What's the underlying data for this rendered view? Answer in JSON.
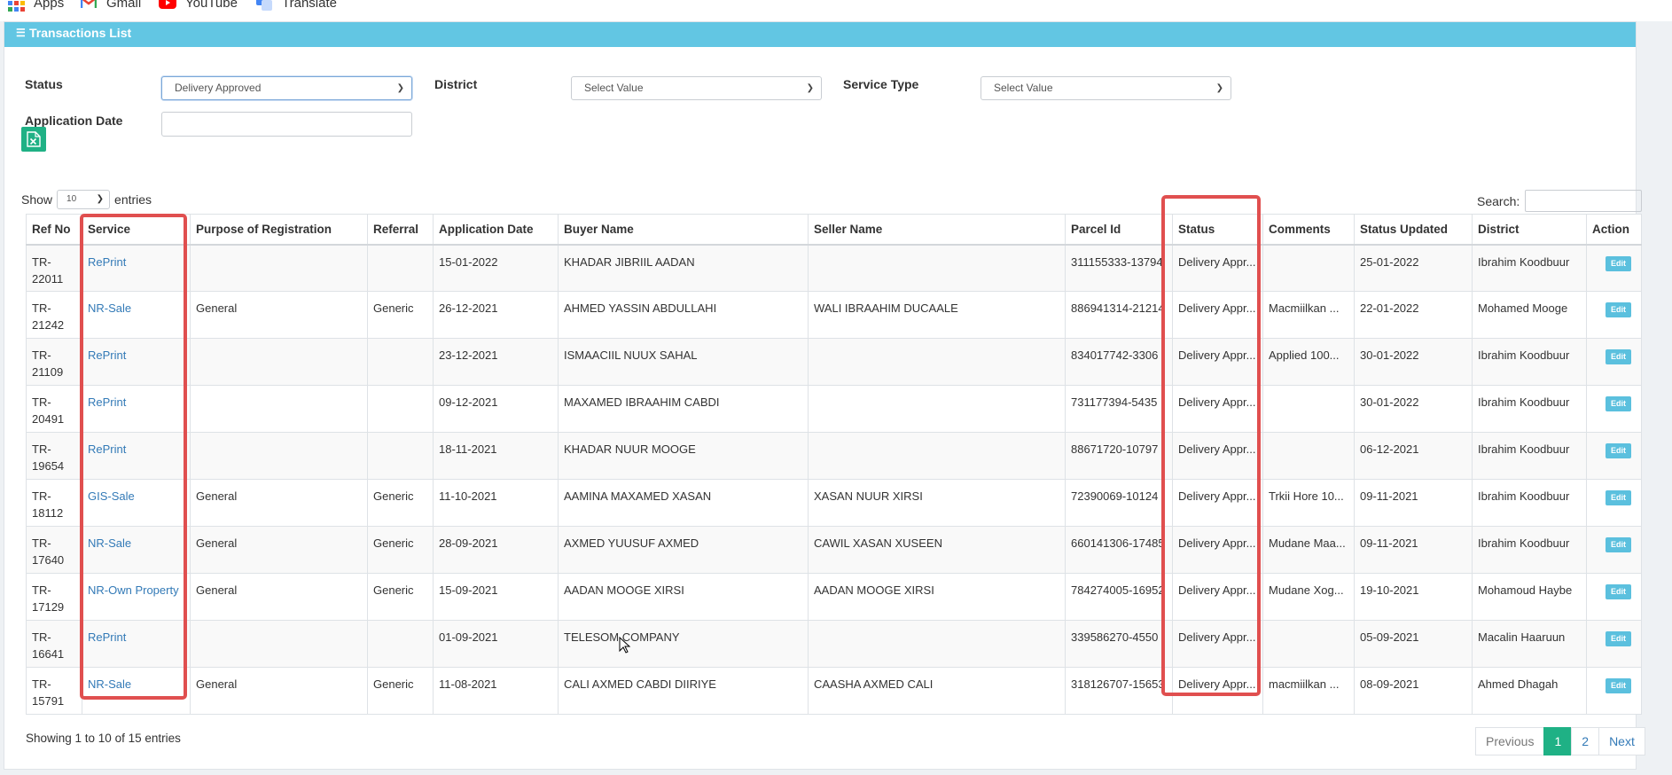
{
  "bookmarks": [
    {
      "label": "Apps",
      "icon": "apps-grid-icon"
    },
    {
      "label": "Gmail",
      "icon": "gmail-icon"
    },
    {
      "label": "YouTube",
      "icon": "youtube-icon"
    },
    {
      "label": "Translate",
      "icon": "translate-icon"
    }
  ],
  "panel": {
    "title": "Transactions List",
    "icon": "list-icon"
  },
  "filters": {
    "status": {
      "label": "Status",
      "value": "Delivery Approved"
    },
    "district": {
      "label": "District",
      "value": "Select Value"
    },
    "service_type": {
      "label": "Service Type",
      "value": "Select Value"
    },
    "application_date": {
      "label": "Application Date",
      "value": ""
    }
  },
  "export": {
    "icon": "excel-export-icon"
  },
  "length_menu": {
    "prefix": "Show",
    "value": "10",
    "suffix": "entries"
  },
  "search": {
    "label": "Search:",
    "value": ""
  },
  "table": {
    "columns": [
      "Ref No",
      "Service",
      "Purpose of Registration",
      "Referral",
      "Application Date",
      "Buyer Name",
      "Seller Name",
      "Parcel Id",
      "Status",
      "Comments",
      "Status Updated",
      "District",
      "Action"
    ],
    "rows": [
      {
        "ref": "TR-22011",
        "service": "RePrint",
        "purpose": "",
        "referral": "",
        "app_date": "15-01-2022",
        "buyer": "KHADAR JIBRIIL AADAN",
        "seller": "",
        "parcel": "311155333-13794",
        "status": "Delivery Appr...",
        "comments": "",
        "updated": "25-01-2022",
        "district": "Ibrahim Koodbuur",
        "action": "Edit"
      },
      {
        "ref": "TR-21242",
        "service": "NR-Sale",
        "purpose": "General",
        "referral": "Generic",
        "app_date": "26-12-2021",
        "buyer": "AHMED YASSIN ABDULLAHI",
        "seller": "WALI IBRAAHIM DUCAALE",
        "parcel": "886941314-21214",
        "status": "Delivery Appr...",
        "comments": "Macmiilkan ...",
        "updated": "22-01-2022",
        "district": "Mohamed Mooge",
        "action": "Edit"
      },
      {
        "ref": "TR-21109",
        "service": "RePrint",
        "purpose": "",
        "referral": "",
        "app_date": "23-12-2021",
        "buyer": "ISMAACIIL NUUX SAHAL",
        "seller": "",
        "parcel": "834017742-3306",
        "status": "Delivery Appr...",
        "comments": "Applied 100...",
        "updated": "30-01-2022",
        "district": "Ibrahim Koodbuur",
        "action": "Edit"
      },
      {
        "ref": "TR-20491",
        "service": "RePrint",
        "purpose": "",
        "referral": "",
        "app_date": "09-12-2021",
        "buyer": "MAXAMED IBRAAHIM CABDI",
        "seller": "",
        "parcel": "731177394-5435",
        "status": "Delivery Appr...",
        "comments": "",
        "updated": "30-01-2022",
        "district": "Ibrahim Koodbuur",
        "action": "Edit"
      },
      {
        "ref": "TR-19654",
        "service": "RePrint",
        "purpose": "",
        "referral": "",
        "app_date": "18-11-2021",
        "buyer": "KHADAR NUUR MOOGE",
        "seller": "",
        "parcel": "88671720-10797",
        "status": "Delivery Appr...",
        "comments": "",
        "updated": "06-12-2021",
        "district": "Ibrahim Koodbuur",
        "action": "Edit"
      },
      {
        "ref": "TR-18112",
        "service": "GIS-Sale",
        "purpose": "General",
        "referral": "Generic",
        "app_date": "11-10-2021",
        "buyer": "AAMINA MAXAMED XASAN",
        "seller": "XASAN NUUR XIRSI",
        "parcel": "72390069-10124",
        "status": "Delivery Appr...",
        "comments": "Trkii Hore 10...",
        "updated": "09-11-2021",
        "district": "Ibrahim Koodbuur",
        "action": "Edit"
      },
      {
        "ref": "TR-17640",
        "service": "NR-Sale",
        "purpose": "General",
        "referral": "Generic",
        "app_date": "28-09-2021",
        "buyer": "AXMED YUUSUF AXMED",
        "seller": "CAWIL XASAN XUSEEN",
        "parcel": "660141306-17485",
        "status": "Delivery Appr...",
        "comments": "Mudane Maa...",
        "updated": "09-11-2021",
        "district": "Ibrahim Koodbuur",
        "action": "Edit"
      },
      {
        "ref": "TR-17129",
        "service": "NR-Own Property",
        "purpose": "General",
        "referral": "Generic",
        "app_date": "15-09-2021",
        "buyer": "AADAN MOOGE XIRSI",
        "seller": "AADAN MOOGE XIRSI",
        "parcel": "784274005-16952",
        "status": "Delivery Appr...",
        "comments": "Mudane Xog...",
        "updated": "19-10-2021",
        "district": "Mohamoud Haybe",
        "action": "Edit"
      },
      {
        "ref": "TR-16641",
        "service": "RePrint",
        "purpose": "",
        "referral": "",
        "app_date": "01-09-2021",
        "buyer": "TELESOM COMPANY",
        "seller": "",
        "parcel": "339586270-4550",
        "status": "Delivery Appr...",
        "comments": "",
        "updated": "05-09-2021",
        "district": "Macalin Haaruun",
        "action": "Edit"
      },
      {
        "ref": "TR-15791",
        "service": "NR-Sale",
        "purpose": "General",
        "referral": "Generic",
        "app_date": "11-08-2021",
        "buyer": "CALI AXMED CABDI DIIRIYE",
        "seller": "CAASHA AXMED CALI",
        "parcel": "318126707-15653",
        "status": "Delivery Appr...",
        "comments": "macmiilkan ...",
        "updated": "08-09-2021",
        "district": "Ahmed Dhagah",
        "action": "Edit"
      }
    ]
  },
  "footer": {
    "info": "Showing 1 to 10 of 15 entries"
  },
  "pagination": {
    "previous": "Previous",
    "pages": [
      "1",
      "2"
    ],
    "current": "1",
    "next": "Next"
  },
  "highlight_color": "#e04f4f",
  "header_color": "#62c6e3",
  "accent_green": "#1fb185"
}
